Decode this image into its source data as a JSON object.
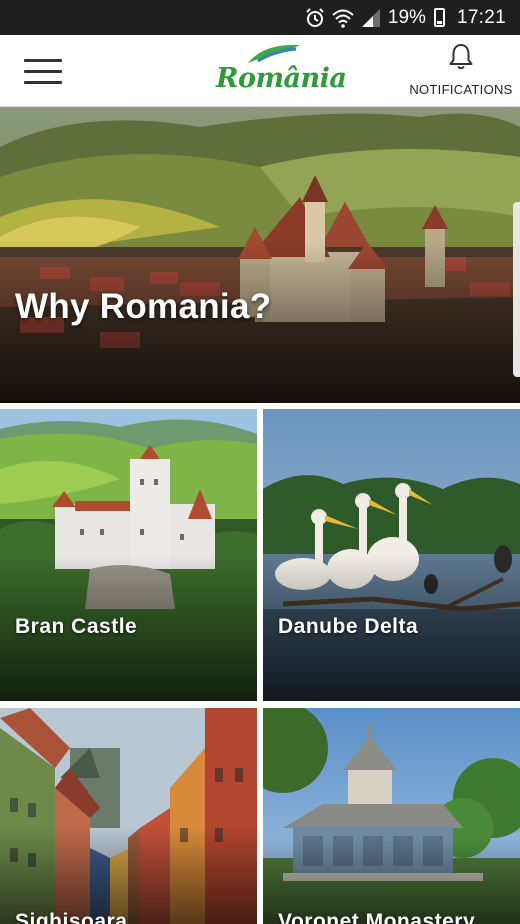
{
  "status_bar": {
    "icons": [
      "alarm-icon",
      "wifi-icon",
      "signal-icon"
    ],
    "battery_percent": "19%",
    "time": "17:21"
  },
  "header": {
    "logo_text": "România",
    "notifications_label": "NOTIFICATIONS"
  },
  "hero": {
    "title": "Why Romania?"
  },
  "tiles": [
    {
      "title": "Bran Castle"
    },
    {
      "title": "Danube Delta"
    },
    {
      "title": "Sighisoara"
    },
    {
      "title": "Voronet Monastery"
    }
  ],
  "colors": {
    "status_bar_bg": "#1f1f1f",
    "header_bg": "#ffffff",
    "logo_green": "#2e9a3a",
    "logo_blue": "#3a7ec2"
  }
}
